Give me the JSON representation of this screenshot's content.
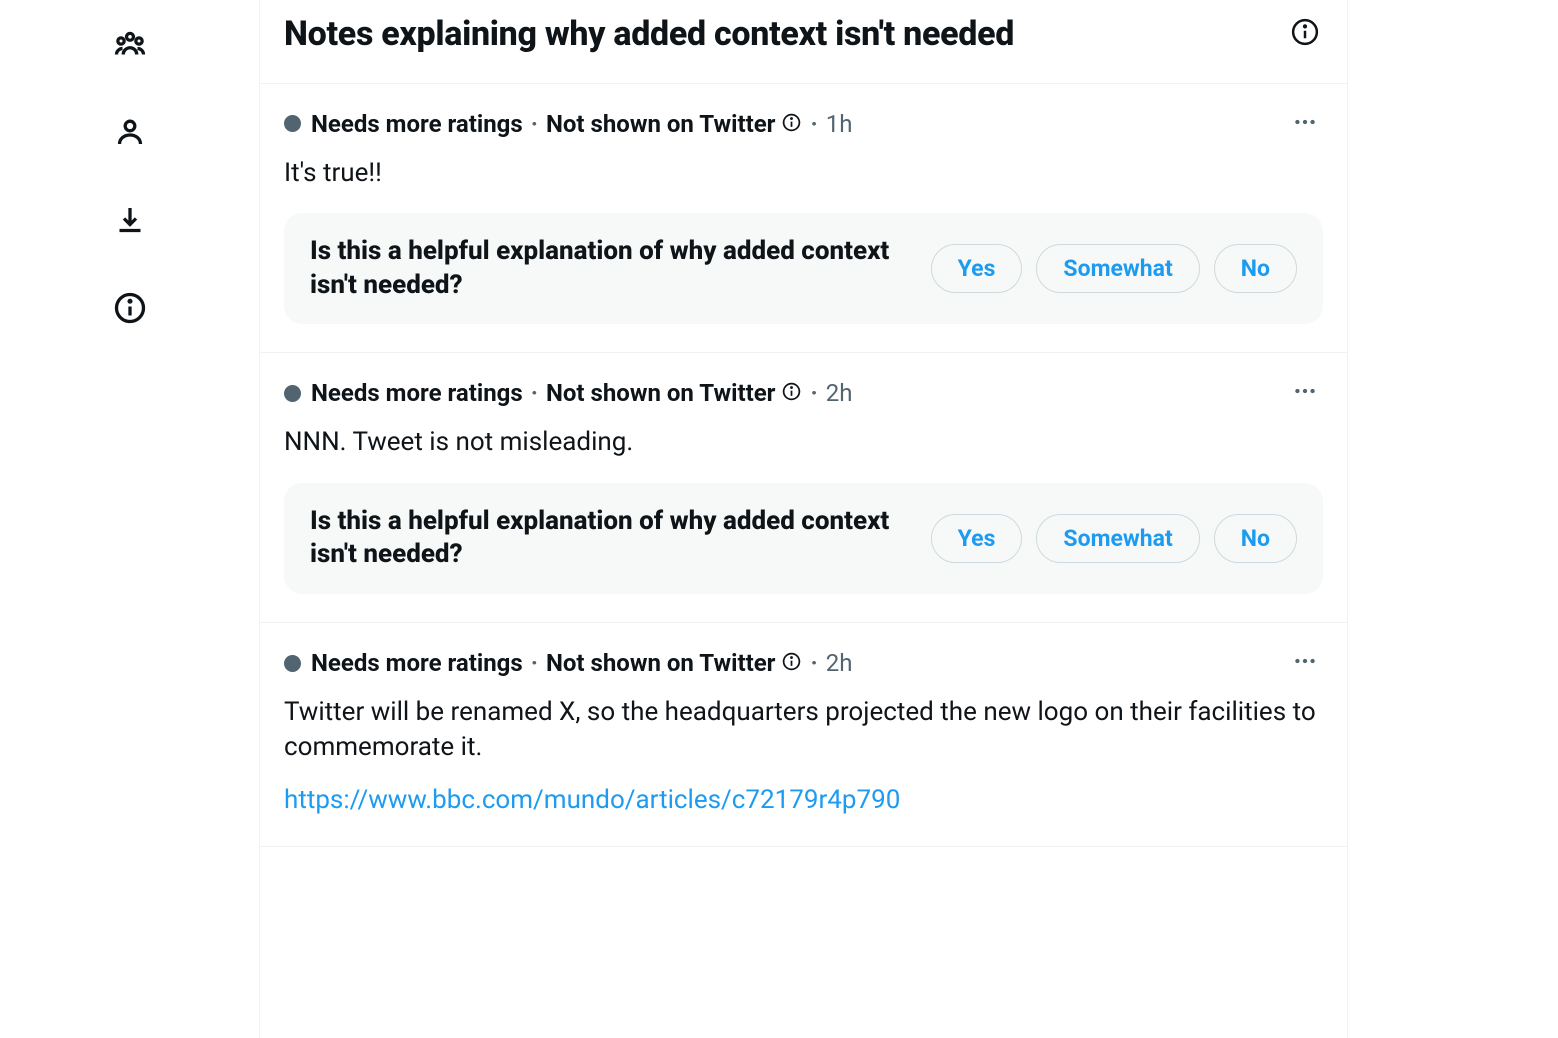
{
  "sidebar": {
    "icons": [
      "people-icon",
      "profile-icon",
      "download-icon",
      "info-icon"
    ]
  },
  "header": {
    "title": "Notes explaining why added context isn't needed"
  },
  "prompt": {
    "question": "Is this a helpful explanation of why added context isn't needed?",
    "answers": {
      "yes": "Yes",
      "somewhat": "Somewhat",
      "no": "No"
    }
  },
  "notes": [
    {
      "status": "Needs more ratings",
      "visibility": "Not shown on Twitter",
      "time": "1h",
      "body": "It's true!!",
      "link": null,
      "show_prompt": true
    },
    {
      "status": "Needs more ratings",
      "visibility": "Not shown on Twitter",
      "time": "2h",
      "body": "NNN. Tweet is not misleading.",
      "link": null,
      "show_prompt": true
    },
    {
      "status": "Needs more ratings",
      "visibility": "Not shown on Twitter",
      "time": "2h",
      "body": "Twitter will be renamed X, so the headquarters projected the new logo on their facilities to commemorate it.",
      "link": "https://www.bbc.com/mundo/articles/c72179r4p790",
      "show_prompt": false
    }
  ]
}
